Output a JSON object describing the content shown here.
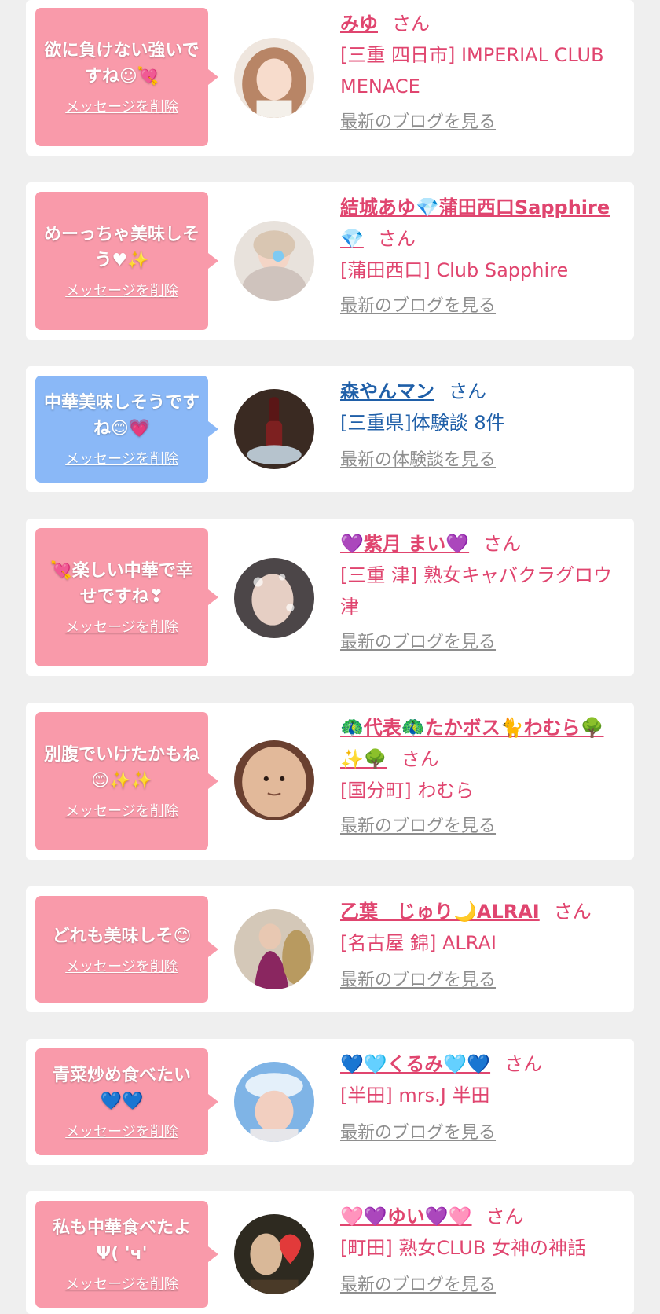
{
  "entries": [
    {
      "message": "欲に負けない強いですね☺💘",
      "delete_label": "メッセージを削除",
      "bubble_color": "pink",
      "name": "みゆ",
      "san": "さん",
      "shop": "[三重 四日市] IMPERIAL CLUB MENACE",
      "blog_link": "最新のブログを見る"
    },
    {
      "message": "めーっちゃ美味しそう♥✨",
      "delete_label": "メッセージを削除",
      "bubble_color": "pink",
      "name": "結城あゆ💎蒲田西口Sapphire💎",
      "san": "さん",
      "shop": "[蒲田西口] Club Sapphire",
      "blog_link": "最新のブログを見る"
    },
    {
      "message": "中華美味しそうですね😊💗",
      "delete_label": "メッセージを削除",
      "bubble_color": "blue",
      "name": "森やんマン",
      "san": "さん",
      "shop": "[三重県]体験談 8件",
      "blog_link": "最新の体験談を見る"
    },
    {
      "message": "💘楽しい中華で幸せですね❣",
      "delete_label": "メッセージを削除",
      "bubble_color": "pink",
      "name": "💜紫月 まい💜",
      "san": "さん",
      "shop": "[三重 津] 熟女キャバクラグロウ津",
      "blog_link": "最新のブログを見る"
    },
    {
      "message": "別腹でいけたかもね😊✨✨",
      "delete_label": "メッセージを削除",
      "bubble_color": "pink",
      "name": "🦚代表🦚たかボス🐈わむら🌳✨🌳",
      "san": "さん",
      "shop": "[国分町] わむら",
      "blog_link": "最新のブログを見る"
    },
    {
      "message": "どれも美味しそ😊",
      "delete_label": "メッセージを削除",
      "bubble_color": "pink",
      "name": "乙葉　じゅり🌙ALRAI",
      "san": "さん",
      "shop": "[名古屋 錦] ALRAI",
      "blog_link": "最新のブログを見る"
    },
    {
      "message": "青菜炒め食べたい💙💙",
      "delete_label": "メッセージを削除",
      "bubble_color": "pink",
      "name": "💙🩵くるみ🩵💙",
      "san": "さん",
      "shop": "[半田] mrs.J 半田",
      "blog_link": "最新のブログを見る"
    },
    {
      "message": "私も中華食べたよΨ( 'ч' ",
      "delete_label": "メッセージを削除",
      "bubble_color": "pink",
      "name": "🩷💜ゆい💜🩷",
      "san": "さん",
      "shop": "[町田] 熟女CLUB 女神の神話",
      "blog_link": "最新のブログを見る"
    }
  ],
  "colors": {
    "background": "#efefef",
    "pink_bubble": "#f99aaa",
    "blue_bubble": "#8ab8f7",
    "name_pink": "#e0456f",
    "name_blue": "#1f5fa8",
    "link_gray": "#8e8e8e"
  }
}
